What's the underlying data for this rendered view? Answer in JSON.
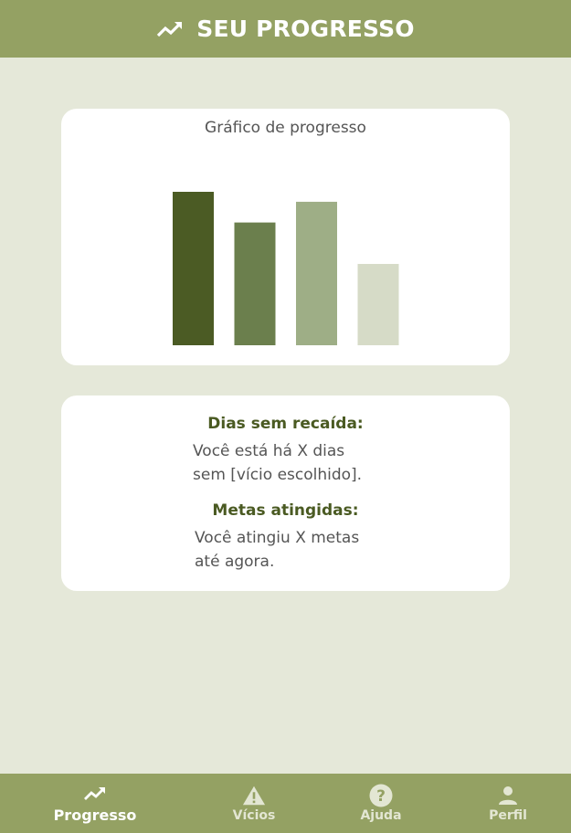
{
  "header": {
    "icon": "trending-up-icon",
    "title": "SEU PROGRESSO"
  },
  "colors": {
    "primary": "#94a163",
    "background": "#e5e8d9",
    "title_text": "#4a5a22"
  },
  "chart_data": {
    "type": "bar",
    "title": "Gráfico de progresso",
    "categories": [
      "",
      "",
      "",
      ""
    ],
    "values": [
      100,
      80,
      93.5,
      53
    ],
    "colors": [
      "#4b5b24",
      "#6b7f4d",
      "#9eae86",
      "#d6dbc7"
    ],
    "ylim": [
      0,
      100
    ],
    "grid": false
  },
  "info": {
    "days_title": "Dias sem recaída:",
    "days_text": "Você está há X dias\nsem [vício escolhido].",
    "goals_title": "Metas atingidas:",
    "goals_text": "Você atingiu X metas\naté agora."
  },
  "nav": [
    {
      "label": "Progresso",
      "icon": "trending-up-icon",
      "active": true
    },
    {
      "label": "Vícios",
      "icon": "warning-icon",
      "active": false
    },
    {
      "label": "Ajuda",
      "icon": "help-circle-icon",
      "active": false
    },
    {
      "label": "Perfil",
      "icon": "person-icon",
      "active": false
    }
  ]
}
